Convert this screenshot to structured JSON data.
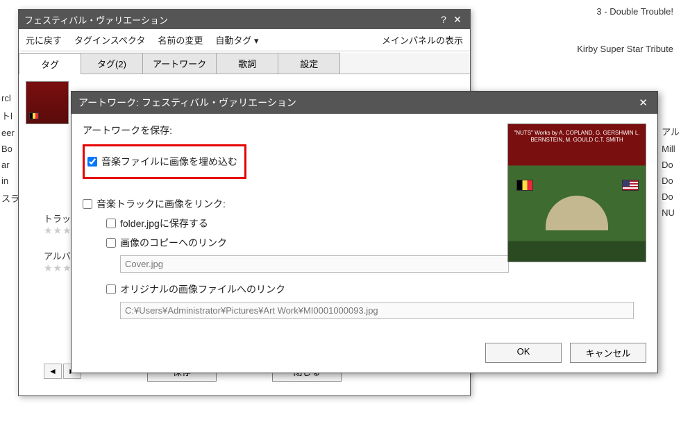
{
  "background": {
    "top_right_1": "3 - Double Trouble!",
    "top_right_2": "Kirby Super Star Tribute",
    "left_fragments": [
      "rcl",
      "トl",
      "eer",
      "Bo",
      "ar",
      "in",
      "スラ"
    ],
    "right_fragments": [
      "アル",
      "Mill",
      "Do",
      "Do",
      "Do",
      "NU"
    ]
  },
  "main_dialog": {
    "title": "フェスティバル・ヴァリエーション",
    "help_icon": "?",
    "close_icon": "✕",
    "toolbar": {
      "undo": "元に戻す",
      "tag_inspector": "タグインスペクタ",
      "rename": "名前の変更",
      "auto_tag": "自動タグ ▾",
      "main_panel": "メインパネルの表示"
    },
    "tabs": {
      "tag": "タグ",
      "tag2": "タグ(2)",
      "artwork": "アートワーク",
      "lyrics": "歌詞",
      "settings": "設定"
    },
    "side": {
      "track_label": "トラック",
      "album_label": "アルバム",
      "stars": "★★★★★"
    },
    "nav": {
      "prev": "◄",
      "next": "►"
    },
    "buttons": {
      "save": "保存",
      "close": "閉じる"
    }
  },
  "artwork_dialog": {
    "title": "アートワーク: フェスティバル・ヴァリエーション",
    "close_icon": "✕",
    "save_artwork_label": "アートワークを保存:",
    "embed_image": "音楽ファイルに画像を埋め込む",
    "link_image_to_track": "音楽トラックに画像をリンク:",
    "save_as_folder_jpg": "folder.jpgに保存する",
    "link_to_copy": "画像のコピーへのリンク",
    "copy_filename": "Cover.jpg",
    "link_to_original": "オリジナルの画像ファイルへのリンク",
    "original_path": "C:¥Users¥Administrator¥Pictures¥Art Work¥MI0001000093.jpg",
    "album_art_text": "\"NUTS\"\nWorks by\nA. COPLAND, G. GERSHWIN\nL. BERNSTEIN, M. GOULD\nC.T. SMITH",
    "buttons": {
      "ok": "OK",
      "cancel": "キャンセル"
    }
  }
}
